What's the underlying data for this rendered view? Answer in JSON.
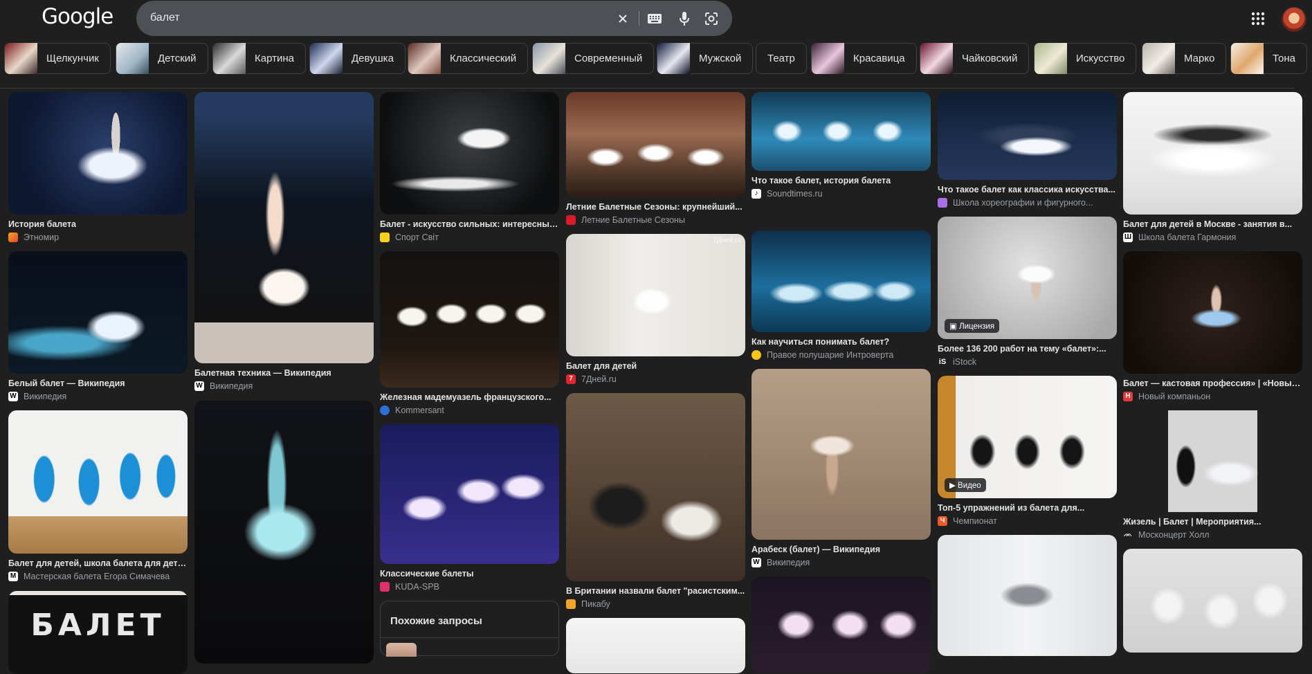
{
  "header": {
    "logo": "Google",
    "query": "балет",
    "colors": {
      "background": "#1f1f1f",
      "searchbox": "#4d5156",
      "text": "#e3e3e3",
      "secondary": "#9aa0a6"
    }
  },
  "chips": [
    {
      "label": "Щелкунчик"
    },
    {
      "label": "Детский"
    },
    {
      "label": "Картина"
    },
    {
      "label": "Девушка"
    },
    {
      "label": "Классический"
    },
    {
      "label": "Современный"
    },
    {
      "label": "Мужской"
    },
    {
      "label": "Театр"
    },
    {
      "label": "Красавица"
    },
    {
      "label": "Чайковский"
    },
    {
      "label": "Искусство"
    },
    {
      "label": "Марко"
    },
    {
      "label": "Тона"
    }
  ],
  "results": [
    {
      "title": "История балета",
      "source": "Этномир"
    },
    {
      "title": "Белый балет — Википедия",
      "source": "Википедия"
    },
    {
      "title": "Балет для детей, школа балета для дете...",
      "source": "Мастерская балета Егора Симачева"
    },
    {
      "title": "Балетная техника — Википедия",
      "source": "Википедия"
    },
    {
      "title": "Балет - искусство сильных: интересные...",
      "source": "Спорт Світ"
    },
    {
      "title": "Железная мадемуазель французского...",
      "source": "Kommersant"
    },
    {
      "title": "Классические балеты",
      "source": "KUDA-SPB"
    },
    {
      "title": "Летние Балетные Сезоны: крупнейший...",
      "source": "Летние Балетные Сезоны"
    },
    {
      "title": "Балет для детей",
      "source": "7Дней.ru"
    },
    {
      "title": "В Британии назвали балет \"расистским...",
      "source": "Пикабу"
    },
    {
      "title": "Что такое балет, история балета",
      "source": "Soundtimes.ru"
    },
    {
      "title": "Как научиться понимать балет?",
      "source": "Правое полушарие Интроверта"
    },
    {
      "title": "Арабеск (балет) — Википедия",
      "source": "Википедия"
    },
    {
      "title": "Что такое балет как классика искусства...",
      "source": "Школа хореографии и фигурного..."
    },
    {
      "title": "Более 136 200 работ на тему «балет»:...",
      "source": "iStock",
      "badge": "Лицензия"
    },
    {
      "title": "Топ-5 упражнений из балета для...",
      "source": "Чемпионат",
      "badge": "Видео"
    },
    {
      "title": "Балет для детей в Москве - занятия в...",
      "source": "Школа балета Гармония"
    },
    {
      "title": "Балет — кастовая профессия» | «Новый...",
      "source": "Новый компаньон"
    },
    {
      "title": "Жизель | Балет | Мероприятия...",
      "source": "Москонцерт Холл"
    }
  ],
  "poster_text": "БАЛЕТ",
  "watermark_text": "7Дней.ru",
  "related": {
    "title": "Похожие запросы"
  }
}
